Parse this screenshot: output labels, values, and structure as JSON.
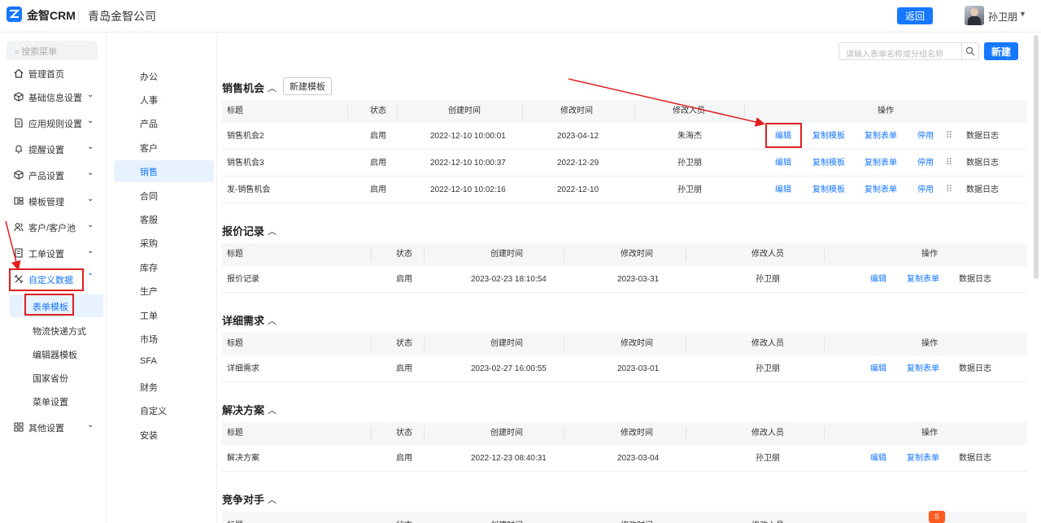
{
  "header": {
    "brand": "金智CRM",
    "company": "青岛金智公司",
    "back_label": "返回",
    "username": "孙卫朋",
    "colors": {
      "accent": "#1677ff"
    }
  },
  "sidebar": {
    "search_placeholder": "搜索菜单",
    "items": [
      {
        "label": "管理首页",
        "icon": "home-icon"
      },
      {
        "label": "基础信息设置",
        "icon": "cube-icon"
      },
      {
        "label": "应用规则设置",
        "icon": "document-icon"
      },
      {
        "label": "提醒设置",
        "icon": "bell-icon"
      },
      {
        "label": "产品设置",
        "icon": "box-icon"
      },
      {
        "label": "模板管理",
        "icon": "template-icon"
      },
      {
        "label": "客户/客户池",
        "icon": "users-icon"
      },
      {
        "label": "工单设置",
        "icon": "ticket-icon"
      },
      {
        "label": "自定义数据",
        "icon": "tools-icon"
      },
      {
        "label": "其他设置",
        "icon": "grid-icon"
      }
    ],
    "sub_items": [
      "表单模板",
      "物流快递方式",
      "编辑器模板",
      "国家省份",
      "菜单设置"
    ]
  },
  "categories": [
    "办公",
    "人事",
    "产品",
    "客户",
    "销售",
    "合同",
    "客服",
    "采购",
    "库存",
    "生产",
    "工单",
    "市场",
    "SFA",
    "财务",
    "自定义",
    "安装"
  ],
  "toolbar": {
    "search_placeholder": "请输入表单名称或分组名称",
    "new_label": "新建"
  },
  "sections": [
    {
      "title": "销售机会",
      "template_button": "新建模板",
      "headers": [
        "标题",
        "状态",
        "创建时间",
        "修改时间",
        "修改人员",
        "操作"
      ],
      "rows": [
        {
          "title": "销售机会2",
          "status": "启用",
          "created": "2022-12-10 10:00:01",
          "modified": "2023-04-12",
          "editor": "朱海杰"
        },
        {
          "title": "销售机会3",
          "status": "启用",
          "created": "2022-12-10 10:00:37",
          "modified": "2022-12-29",
          "editor": "孙卫朋"
        },
        {
          "title": "发-销售机会",
          "status": "启用",
          "created": "2022-12-10 10:02:16",
          "modified": "2022-12-10",
          "editor": "孙卫朋"
        }
      ],
      "actions": [
        "编辑",
        "复制模板",
        "复制表单",
        "停用",
        "数据日志"
      ]
    },
    {
      "title": "报价记录",
      "headers": [
        "标题",
        "状态",
        "创建时间",
        "修改时间",
        "修改人员",
        "操作"
      ],
      "rows": [
        {
          "title": "报价记录",
          "status": "启用",
          "created": "2023-02-23 18:10:54",
          "modified": "2023-03-31",
          "editor": "孙卫朋"
        }
      ],
      "actions": [
        "编辑",
        "复制表单",
        "数据日志"
      ]
    },
    {
      "title": "详细需求",
      "headers": [
        "标题",
        "状态",
        "创建时间",
        "修改时间",
        "修改人员",
        "操作"
      ],
      "rows": [
        {
          "title": "详细需求",
          "status": "启用",
          "created": "2023-02-27 16:00:55",
          "modified": "2023-03-01",
          "editor": "孙卫朋"
        }
      ],
      "actions": [
        "编辑",
        "复制表单",
        "数据日志"
      ]
    },
    {
      "title": "解决方案",
      "headers": [
        "标题",
        "状态",
        "创建时间",
        "修改时间",
        "修改人员",
        "操作"
      ],
      "rows": [
        {
          "title": "解决方案",
          "status": "启用",
          "created": "2022-12-23 08:40:31",
          "modified": "2023-03-04",
          "editor": "孙卫朋"
        }
      ],
      "actions": [
        "编辑",
        "复制表单",
        "数据日志"
      ]
    },
    {
      "title": "竞争对手",
      "headers": [
        "标题",
        "状态",
        "创建时间",
        "修改时间",
        "修改人员"
      ]
    }
  ]
}
